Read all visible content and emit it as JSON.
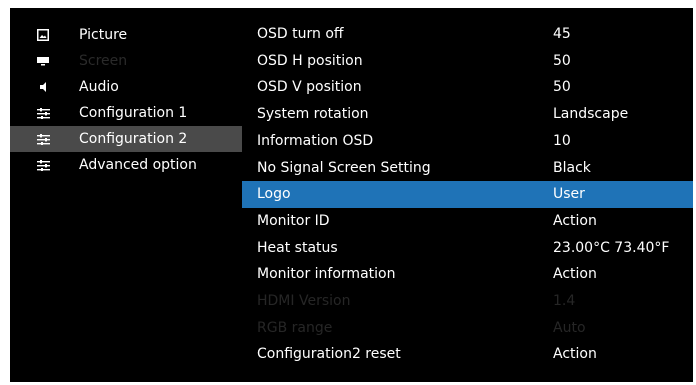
{
  "sidebar": {
    "items": [
      {
        "label": "Picture",
        "icon": "picture-icon"
      },
      {
        "label": "Screen",
        "icon": "screen-icon"
      },
      {
        "label": "Audio",
        "icon": "speaker-icon"
      },
      {
        "label": "Configuration 1",
        "icon": "sliders-icon"
      },
      {
        "label": "Configuration 2",
        "icon": "sliders-icon"
      },
      {
        "label": "Advanced option",
        "icon": "sliders-icon"
      }
    ],
    "selected": "Configuration 2"
  },
  "settings": {
    "rows": [
      {
        "name": "OSD turn off",
        "value": "45"
      },
      {
        "name": "OSD H position",
        "value": "50"
      },
      {
        "name": "OSD V position",
        "value": "50"
      },
      {
        "name": "System rotation",
        "value": "Landscape"
      },
      {
        "name": "Information OSD",
        "value": "10"
      },
      {
        "name": "No Signal Screen Setting",
        "value": "Black"
      },
      {
        "name": "Logo",
        "value": "User"
      },
      {
        "name": "Monitor ID",
        "value": "Action"
      },
      {
        "name": "Heat status",
        "value": "23.00°C 73.40°F"
      },
      {
        "name": "Monitor information",
        "value": "Action"
      },
      {
        "name": "HDMI Version",
        "value": "1.4"
      },
      {
        "name": "RGB range",
        "value": "Auto"
      },
      {
        "name": "Configuration2 reset",
        "value": "Action"
      }
    ],
    "highlighted": "Logo"
  },
  "colors": {
    "background": "#000000",
    "selected_menu": "#4a4a4a",
    "highlight": "#1f73b7",
    "text": "#ffffff",
    "disabled_text": "#262626"
  }
}
